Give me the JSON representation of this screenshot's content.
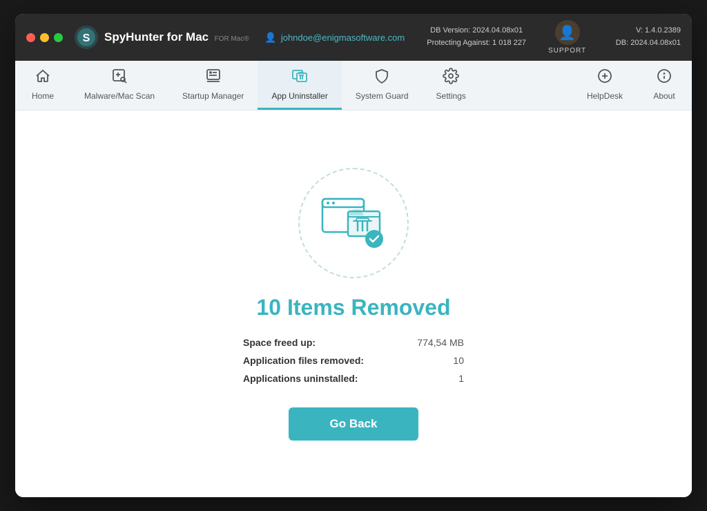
{
  "window": {
    "title": "SpyHunter for Mac"
  },
  "titlebar": {
    "logo_text": "SpyHunter",
    "logo_for": "FOR",
    "logo_mac": "Mac",
    "user_email": "johndoe@enigmasoftware.com",
    "db_version_label": "DB Version:",
    "db_version_value": "2024.04.08x01",
    "protecting_label": "Protecting Against:",
    "protecting_value": "1 018 227",
    "support_label": "SUPPORT",
    "version_label": "V:",
    "version_value": "1.4.0.2389",
    "db_label": "DB:",
    "db_value": "2024.04.08x01"
  },
  "navbar": {
    "items": [
      {
        "id": "home",
        "label": "Home",
        "icon": "🏠",
        "active": false
      },
      {
        "id": "malware-scan",
        "label": "Malware/Mac Scan",
        "icon": "🔍",
        "active": false
      },
      {
        "id": "startup-manager",
        "label": "Startup Manager",
        "icon": "📋",
        "active": false
      },
      {
        "id": "app-uninstaller",
        "label": "App Uninstaller",
        "icon": "📦",
        "active": true
      },
      {
        "id": "system-guard",
        "label": "System Guard",
        "icon": "🛡",
        "active": false
      },
      {
        "id": "settings",
        "label": "Settings",
        "icon": "⚙️",
        "active": false
      }
    ],
    "right_items": [
      {
        "id": "helpdesk",
        "label": "HelpDesk",
        "icon": "➕"
      },
      {
        "id": "about",
        "label": "About",
        "icon": "ℹ"
      }
    ]
  },
  "main": {
    "result_title": "10 Items Removed",
    "stats": [
      {
        "label": "Space freed up:",
        "value": "774,54 MB"
      },
      {
        "label": "Application files removed:",
        "value": "10"
      },
      {
        "label": "Applications uninstalled:",
        "value": "1"
      }
    ],
    "go_back_label": "Go Back"
  }
}
